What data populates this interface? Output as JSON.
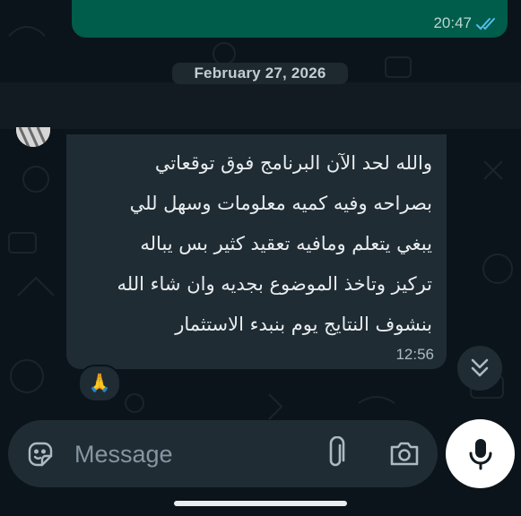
{
  "outgoing_message": {
    "time": "20:47",
    "status_icon": "double-check-read-icon"
  },
  "date_separator": {
    "label": "February 27, 2026"
  },
  "incoming_message": {
    "lines": [
      "والله لحد الآن البرنامج فوق توقعاتي",
      "بصراحه وفيه كميه معلومات وسهل للي",
      "يبغي يتعلم ومافيه تعقيد كثير بس يباله",
      "تركيز وتاخذ الموضوع بجديه وان شاء الله",
      "بنشوف النتايج يوم بنبدء الاستثمار"
    ],
    "time": "12:56",
    "reaction": "🙏"
  },
  "composer": {
    "placeholder": "Message"
  },
  "colors": {
    "background": "#0b141a",
    "incoming_bubble": "#1f2c34",
    "outgoing_bubble": "#005c4b",
    "read_ticks": "#53bdeb",
    "mic_button": "#ffffff"
  }
}
